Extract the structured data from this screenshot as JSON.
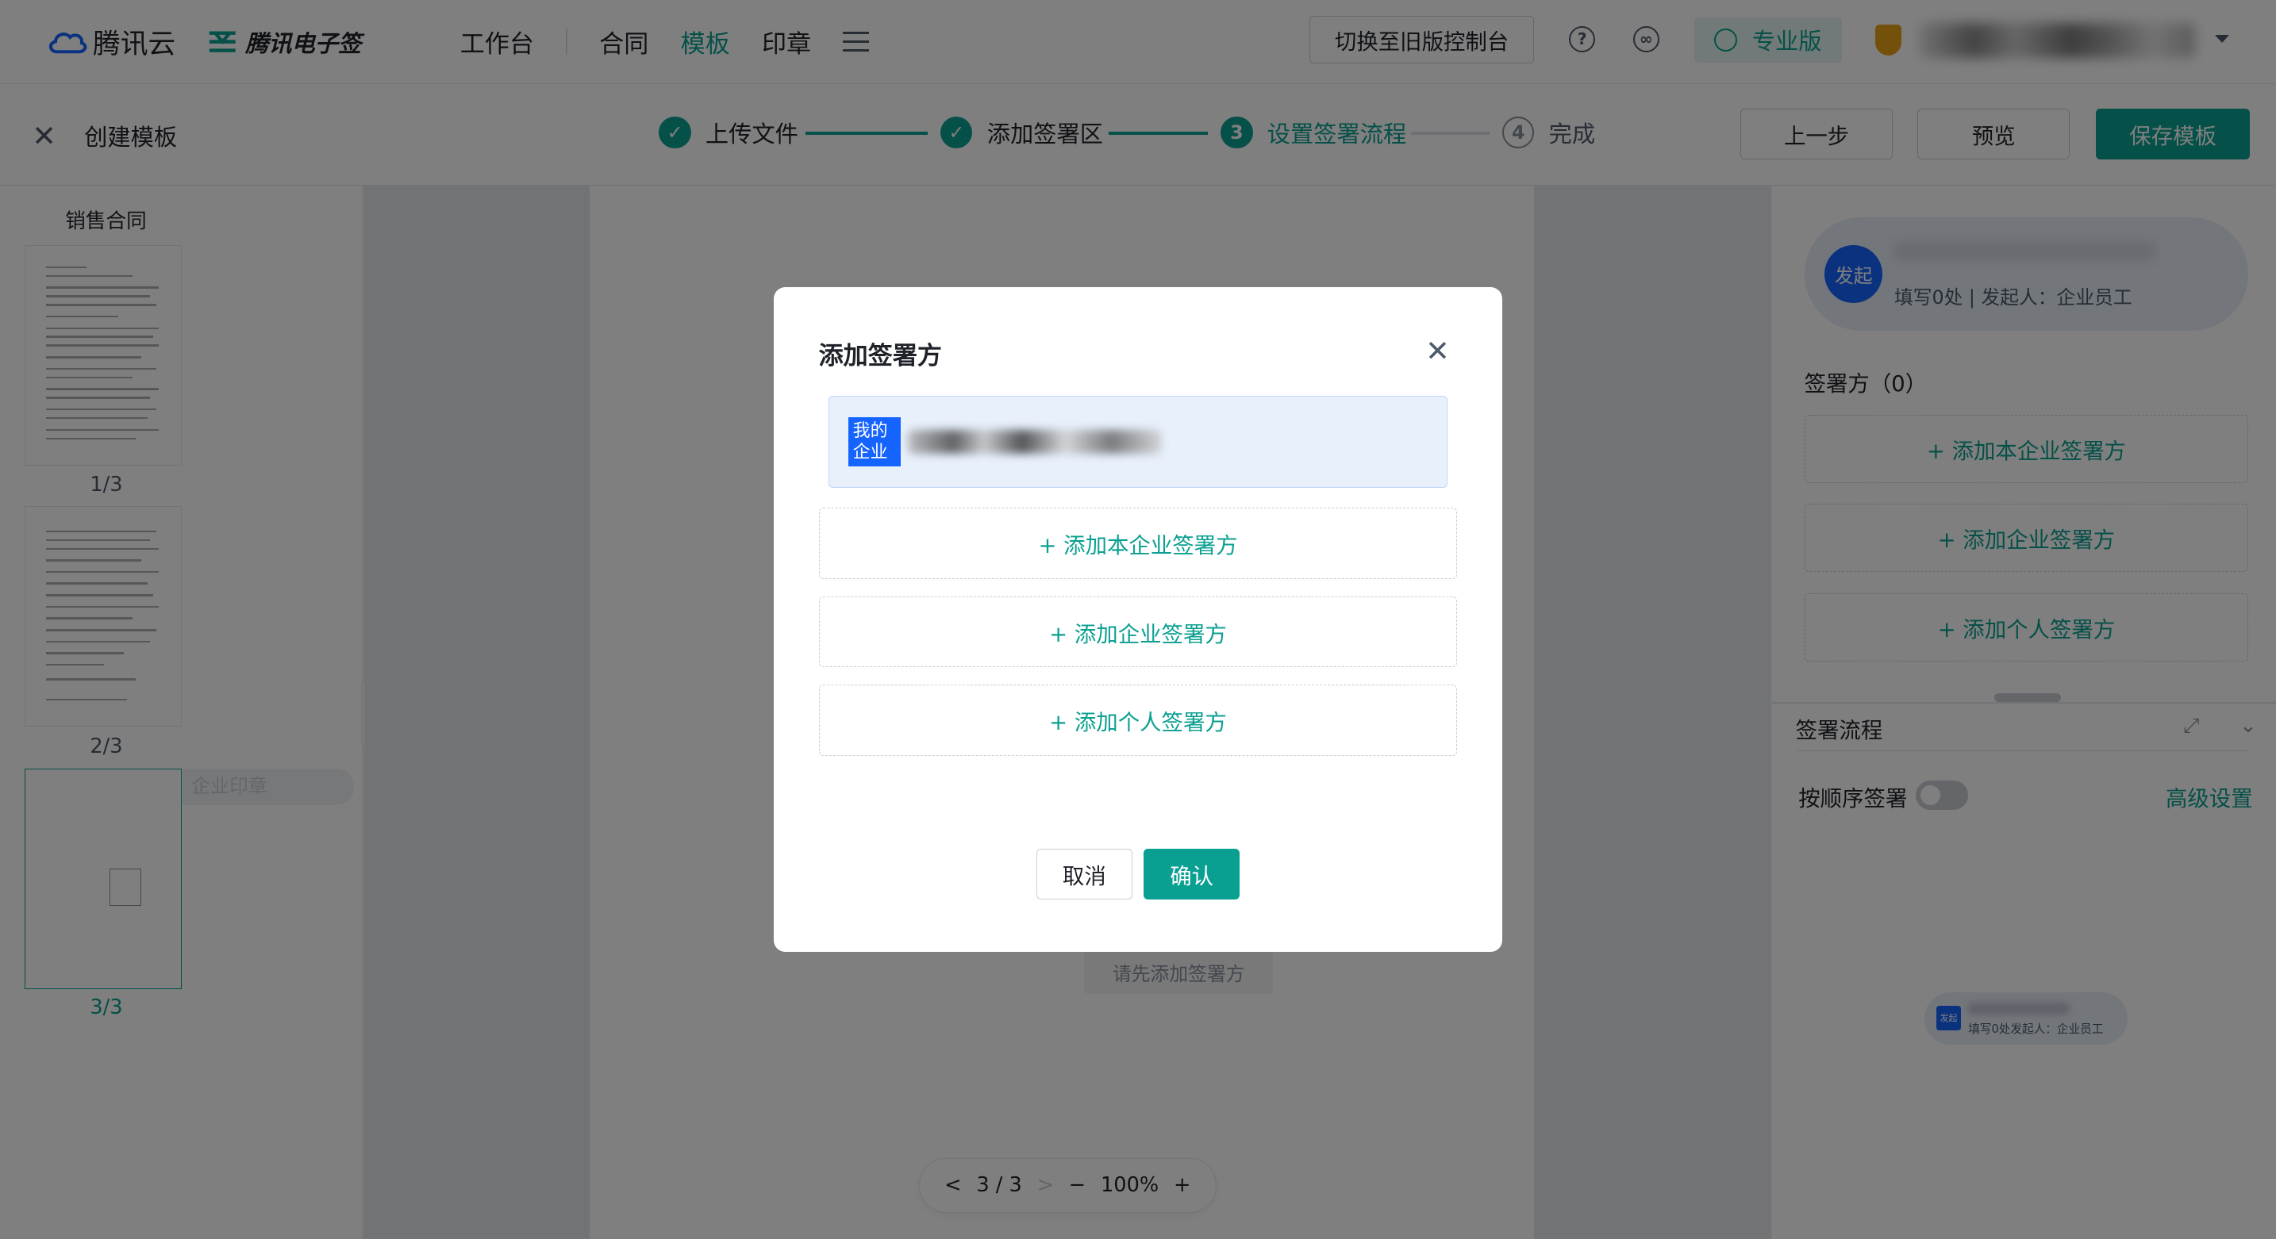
{
  "topnav": {
    "brand_name": "腾讯云",
    "product_name": "腾讯电子签",
    "links": [
      "工作台",
      "合同",
      "模板",
      "印章"
    ],
    "active_link": "模板",
    "switch_button": "切换至旧版控制台",
    "help_icon": "?",
    "edition_badge": "专业版"
  },
  "subheader": {
    "close": "✕",
    "title": "创建模板",
    "steps": [
      {
        "index": "✓",
        "label": "上传文件",
        "state": "done"
      },
      {
        "index": "✓",
        "label": "添加签署区",
        "state": "done"
      },
      {
        "index": "3",
        "label": "设置签署流程",
        "state": "current"
      },
      {
        "index": "4",
        "label": "完成",
        "state": "todo"
      }
    ],
    "prev_button": "上一步",
    "preview_button": "预览",
    "save_button": "保存模板"
  },
  "left_panel": {
    "doc_name": "销售合同",
    "thumbs": [
      {
        "label": "1/3"
      },
      {
        "label": "2/3"
      },
      {
        "label": "3/3"
      }
    ],
    "stamp_pill": "企业印章",
    "collapse": "«"
  },
  "canvas": {
    "placeholder": "请先添加签署方",
    "pager": {
      "prev": "<",
      "page": "3 / 3",
      "next": ">",
      "zoom_out": "−",
      "zoom": "100%",
      "zoom_in": "+"
    }
  },
  "right_panel": {
    "initiator_avatar": "发起",
    "initiator_sub": "填写0处 | 发起人：企业员工",
    "signers_heading": "签署方（0）",
    "add_buttons": [
      "+ 添加本企业签署方",
      "+ 添加企业签署方",
      "+ 添加个人签署方"
    ],
    "flow_heading": "签署流程",
    "order_label": "按顺序签署",
    "advanced_link": "高级设置",
    "mini_node": {
      "avatar": "发起",
      "sub": "填写0处发起人：企业员工"
    }
  },
  "modal": {
    "title": "添加签署方",
    "close": "✕",
    "selected_tag": "我的企业",
    "add_buttons": [
      "+ 添加本企业签署方",
      "+ 添加企业签署方",
      "+ 添加个人签署方"
    ],
    "cancel": "取消",
    "confirm": "确认"
  },
  "colors": {
    "accent": "#0aa091",
    "brand_blue": "#1664ff"
  }
}
